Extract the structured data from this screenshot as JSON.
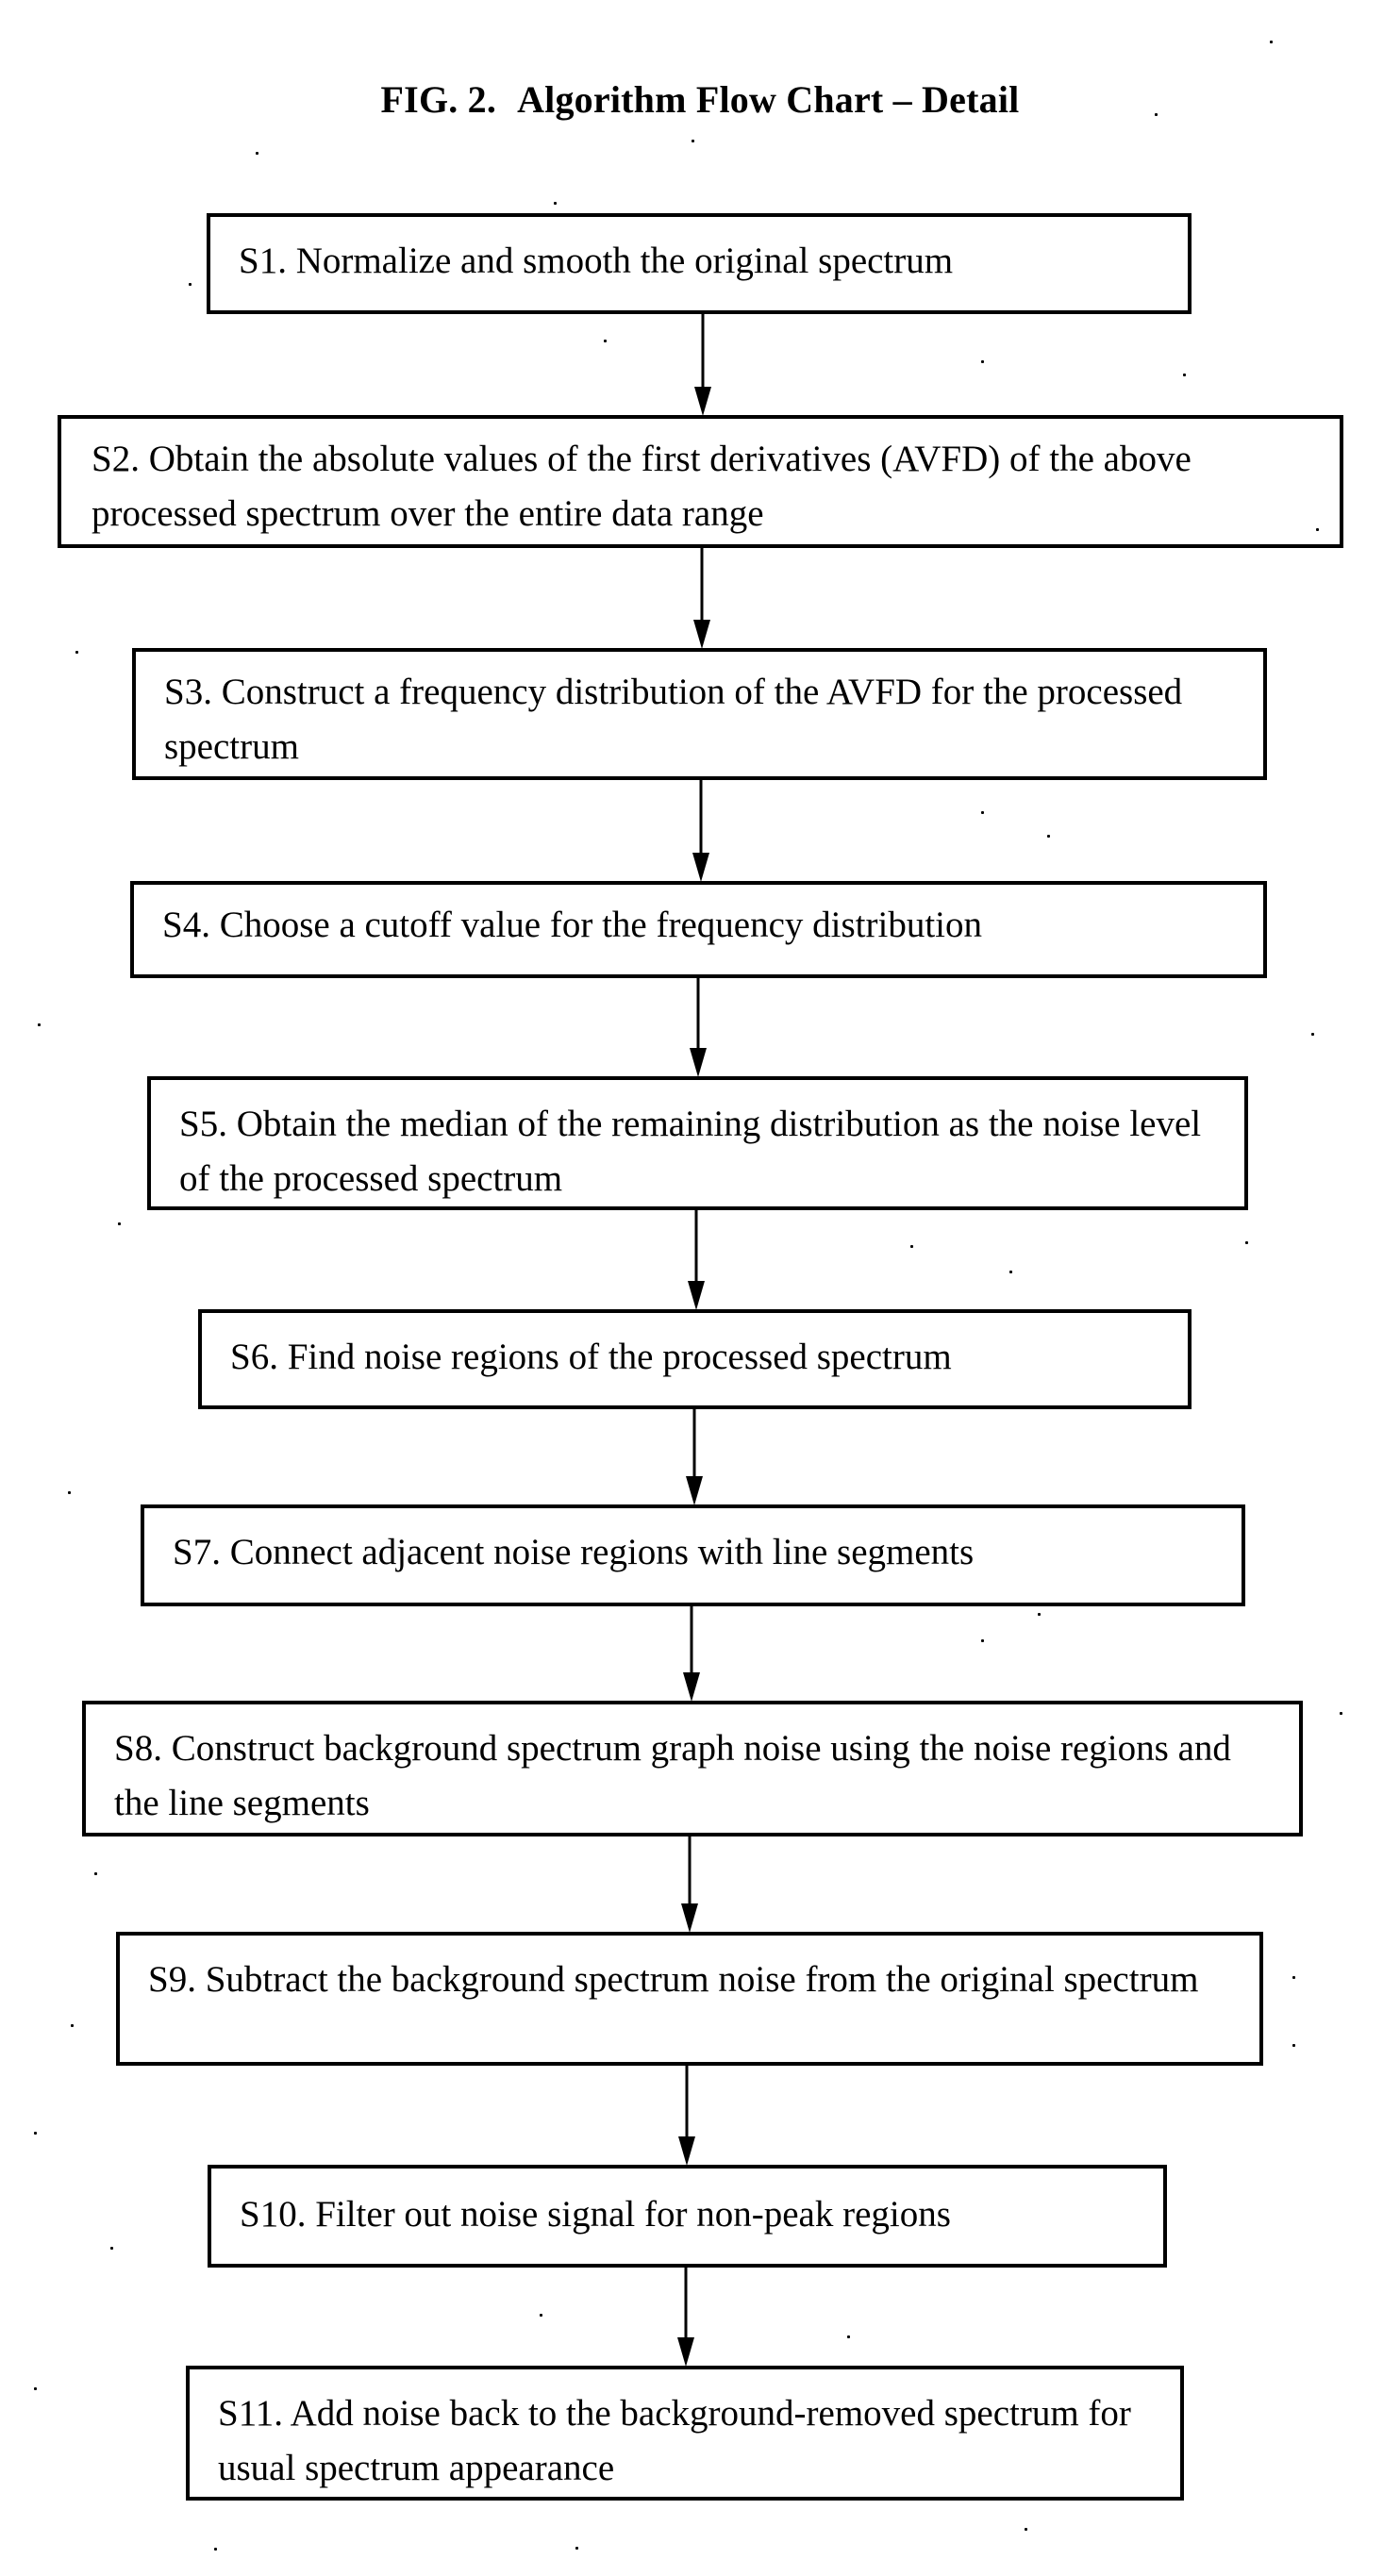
{
  "figure": {
    "label": "FIG. 2.",
    "title": "Algorithm Flow Chart – Detail"
  },
  "steps": [
    {
      "id": "S1",
      "text": "S1.  Normalize and smooth the original spectrum"
    },
    {
      "id": "S2",
      "text": "S2.  Obtain the absolute values of the first derivatives (AVFD) of the above processed spectrum over the entire data range"
    },
    {
      "id": "S3",
      "text": "S3.  Construct a frequency distribution of the AVFD for the processed spectrum"
    },
    {
      "id": "S4",
      "text": "S4. Choose a cutoff value for the frequency distribution"
    },
    {
      "id": "S5",
      "text": "S5. Obtain the median of the remaining distribution as the noise level of the processed spectrum"
    },
    {
      "id": "S6",
      "text": "S6. Find noise regions of the processed spectrum"
    },
    {
      "id": "S7",
      "text": "S7. Connect adjacent noise regions with line segments"
    },
    {
      "id": "S8",
      "text": "S8.  Construct background spectrum graph noise using the noise regions and the line segments"
    },
    {
      "id": "S9",
      "text": "S9.  Subtract the background spectrum noise from the original spectrum"
    },
    {
      "id": "S10",
      "text": "S10. Filter out noise signal for non-peak regions"
    },
    {
      "id": "S11",
      "text": "S11. Add noise back to the background-removed spectrum for usual spectrum appearance"
    }
  ],
  "connections": [
    {
      "from": "S1",
      "to": "S2"
    },
    {
      "from": "S2",
      "to": "S3"
    },
    {
      "from": "S3",
      "to": "S4"
    },
    {
      "from": "S4",
      "to": "S5"
    },
    {
      "from": "S5",
      "to": "S6"
    },
    {
      "from": "S6",
      "to": "S7"
    },
    {
      "from": "S7",
      "to": "S8"
    },
    {
      "from": "S8",
      "to": "S9"
    },
    {
      "from": "S9",
      "to": "S10"
    },
    {
      "from": "S10",
      "to": "S11"
    }
  ]
}
